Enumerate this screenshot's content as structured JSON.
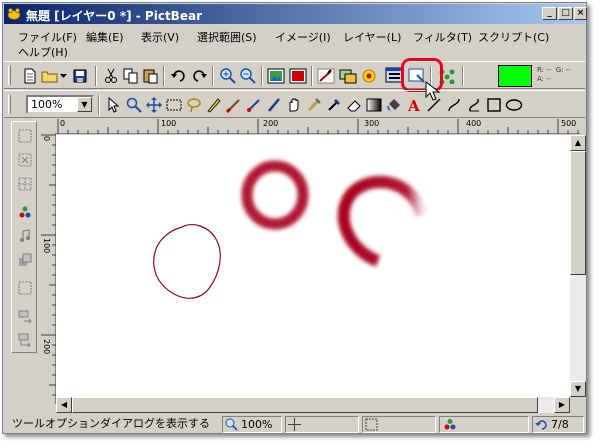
{
  "window": {
    "title": "無題 [レイヤー0 *] - PictBear",
    "controls": [
      "_",
      "□",
      "×"
    ]
  },
  "menubar": {
    "items": [
      {
        "label": "ファイル(F)"
      },
      {
        "label": "編集(E)"
      },
      {
        "label": "表示(V)"
      },
      {
        "label": "選択範囲(S)"
      },
      {
        "label": "イメージ(I)"
      },
      {
        "label": "レイヤー(L)"
      },
      {
        "label": "フィルタ(T)"
      },
      {
        "label": "スクリプト(C)"
      },
      {
        "label": "ヘルプ(H)"
      }
    ]
  },
  "toolbar1": {
    "buttons": [
      "new-file-icon",
      "open-folder-icon",
      "dropdown-arrow-icon",
      "save-disk-icon",
      "cut-icon",
      "copy-icon",
      "paste-icon",
      "undo-icon",
      "redo-icon",
      "zoom-in-icon",
      "zoom-out-icon",
      "image-icon",
      "color-fill-icon",
      "brush-options-icon",
      "layers-icon",
      "toggle-icon",
      "tool-options-dialog-icon",
      "navigator-icon",
      "palette-icon"
    ],
    "foreground_color": "#00ff00",
    "rgb_readout": "R: --  G: --\nA: --"
  },
  "toolbar2": {
    "zoom_value": "100%",
    "tools": [
      "arrow-icon",
      "zoom-tool-icon",
      "move-icon",
      "rect-select-icon",
      "lasso-icon",
      "pencil-icon",
      "brush-icon",
      "airbrush-icon",
      "pen-icon",
      "hand-icon",
      "smudge-icon",
      "dropper-icon",
      "eraser-icon",
      "gradient-icon",
      "bucket-icon",
      "text-icon",
      "line-icon",
      "curve-icon",
      "bezier-icon",
      "rectangle-icon",
      "ellipse-icon"
    ]
  },
  "ruler": {
    "top_labels": [
      "0",
      "100",
      "200",
      "300",
      "400",
      "500"
    ],
    "left_labels": [
      "0",
      "100",
      "200"
    ]
  },
  "status": {
    "message": "ツールオプションダイアログを表示する",
    "zoom": "100%",
    "history": "7/8"
  },
  "colors": {
    "highlight": "#e8001a",
    "stroke_red": "#a8001e",
    "thin_stroke": "#8b0a1e"
  }
}
